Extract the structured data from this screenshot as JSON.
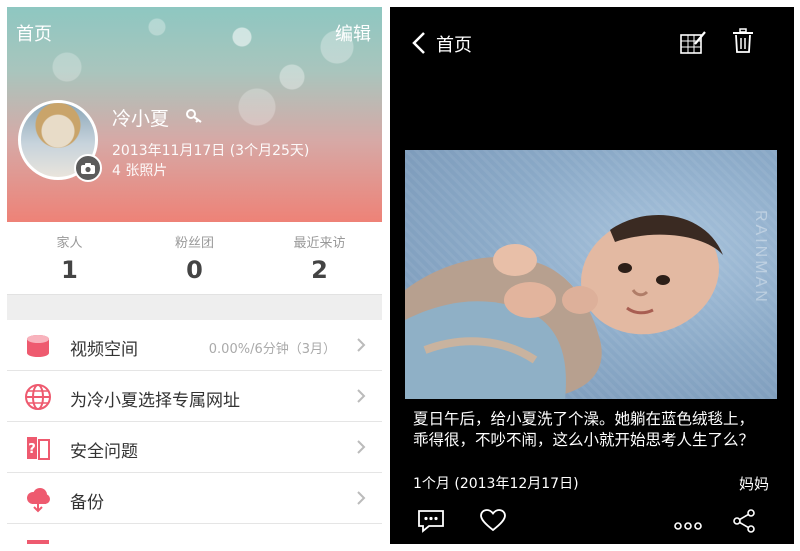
{
  "left": {
    "nav": {
      "back_label": "首页",
      "edit_label": "编辑"
    },
    "profile": {
      "name": "冷小夏",
      "birth": "2013年11月17日 (3个月25天)",
      "photos": "4 张照片"
    },
    "stats": [
      {
        "label": "家人",
        "value": "1"
      },
      {
        "label": "粉丝团",
        "value": "0"
      },
      {
        "label": "最近来访",
        "value": "2"
      }
    ],
    "menu": [
      {
        "icon": "storage-icon",
        "label": "视频空间",
        "value": "0.00%/6分钟（3月）"
      },
      {
        "icon": "globe-icon",
        "label": "为冷小夏选择专属网址",
        "value": ""
      },
      {
        "icon": "security-question-icon",
        "label": "安全问题",
        "value": ""
      },
      {
        "icon": "cloud-backup-icon",
        "label": "备份",
        "value": ""
      }
    ]
  },
  "right": {
    "nav": {
      "back_label": "首页"
    },
    "caption": "夏日午后，给小夏洗了个澡。她躺在蓝色绒毯上，乖得很，不吵不闹，这么小就开始思考人生了么？",
    "age_date": "1个月 (2013年12月17日)",
    "author": "妈妈",
    "watermark": "RAINMAN"
  },
  "colors": {
    "accent": "#ee5a6f",
    "hero_top": "#8ec7c1",
    "hero_bottom": "#ee8277",
    "dark_bg": "#000000"
  }
}
